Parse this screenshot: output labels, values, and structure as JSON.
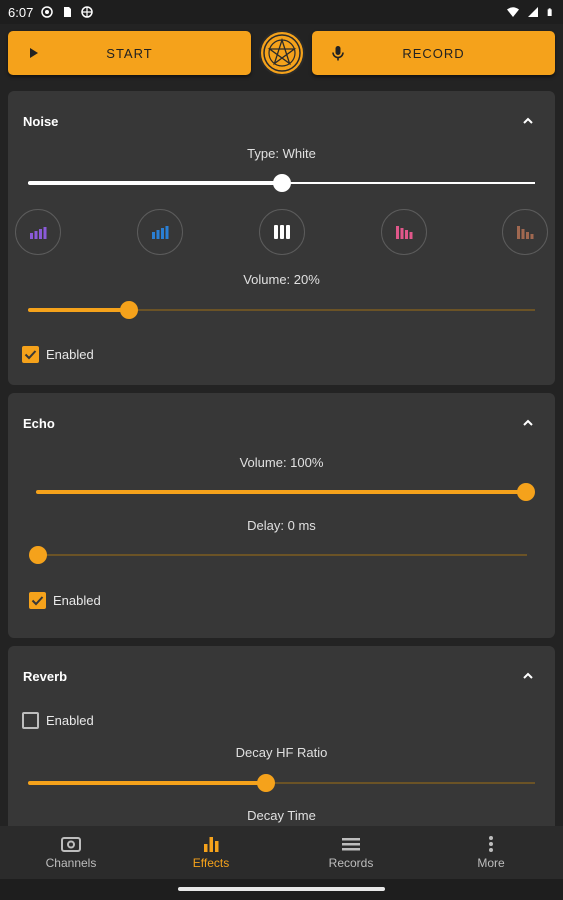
{
  "status_bar": {
    "time": "6:07"
  },
  "top_bar": {
    "start_label": "START",
    "record_label": "RECORD"
  },
  "noise": {
    "title": "Noise",
    "type_label": "Type: White",
    "type_slider_value": 0.5,
    "colors": [
      "#8a5ad8",
      "#2a7fd4",
      "#ffffff",
      "#e0578a",
      "#a06850"
    ],
    "volume_label": "Volume: 20%",
    "volume_value": 0.2,
    "enabled_label": "Enabled",
    "enabled_checked": true
  },
  "echo": {
    "title": "Echo",
    "volume_label": "Volume: 100%",
    "volume_value": 1.0,
    "delay_label": "Delay: 0 ms",
    "delay_value": 0.0,
    "enabled_label": "Enabled",
    "enabled_checked": true
  },
  "reverb": {
    "title": "Reverb",
    "enabled_label": "Enabled",
    "enabled_checked": false,
    "decay_hf_label": "Decay HF Ratio",
    "decay_hf_value": 0.47,
    "decay_time_label": "Decay Time"
  },
  "bottom_nav": {
    "channels": "Channels",
    "effects": "Effects",
    "records": "Records",
    "more": "More"
  },
  "colors": {
    "accent": "#f5a21b",
    "card": "#373737",
    "background": "#232323"
  }
}
